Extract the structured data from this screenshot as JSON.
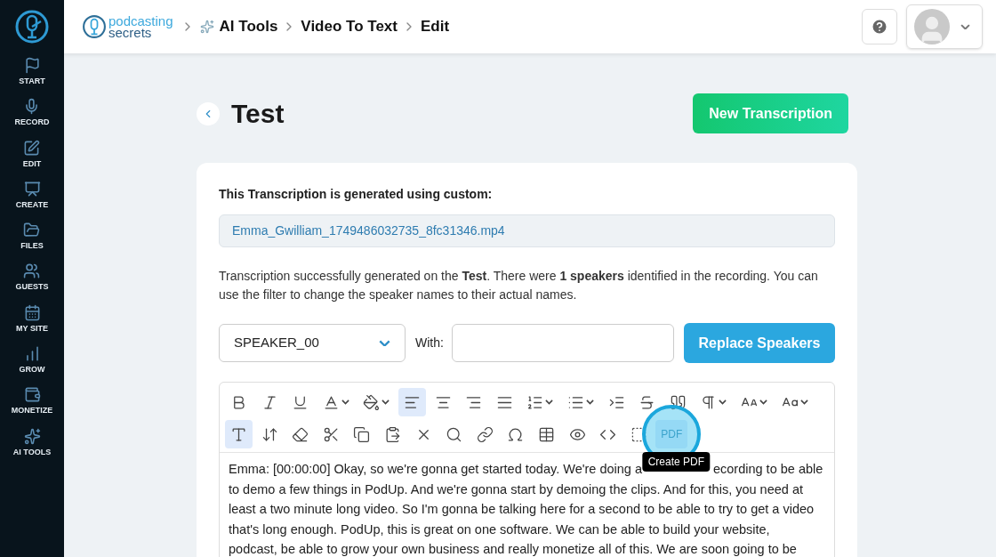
{
  "sidebar": {
    "items": [
      {
        "label": "START"
      },
      {
        "label": "RECORD"
      },
      {
        "label": "EDIT"
      },
      {
        "label": "CREATE"
      },
      {
        "label": "FILES"
      },
      {
        "label": "GUESTS"
      },
      {
        "label": "MY SITE"
      },
      {
        "label": "GROW"
      },
      {
        "label": "MONETIZE"
      },
      {
        "label": "AI TOOLS"
      }
    ]
  },
  "header": {
    "logo": {
      "line_1": "podcasting",
      "line_2": "secrets"
    },
    "breadcrumbs": [
      "AI Tools",
      "Video To Text",
      "Edit"
    ]
  },
  "page": {
    "title": "Test",
    "new_button": "New Transcription"
  },
  "card": {
    "source_label": "This Transcription is generated using custom:",
    "file_name": "Emma_Gwilliam_1749486032735_8fc31346.mp4",
    "info": "Transcription successfully generated on the **Test**. There were **1 speakers** identified in the recording. You can use the filter to change the speaker names to their actual names.",
    "speaker_select": "SPEAKER_00",
    "with_label": "With:",
    "replace_button": "Replace Speakers"
  },
  "editor": {
    "rows": [
      [
        {
          "selected": false,
          "dropdown": false
        },
        {
          "selected": false,
          "dropdown": false
        },
        {
          "selected": false,
          "dropdown": false
        },
        {
          "selected": false,
          "dropdown": true
        },
        {
          "selected": false,
          "dropdown": true
        },
        {
          "selected": true,
          "dropdown": false
        },
        {
          "selected": false,
          "dropdown": false
        },
        {
          "selected": false,
          "dropdown": false
        },
        {
          "selected": false,
          "dropdown": false
        },
        {
          "selected": false,
          "dropdown": true
        },
        {
          "selected": false,
          "dropdown": true
        },
        {
          "selected": false,
          "dropdown": false
        },
        {
          "selected": false,
          "dropdown": false
        },
        {
          "selected": false,
          "dropdown": false
        },
        {
          "selected": false,
          "dropdown": true
        },
        {
          "selected": false,
          "dropdown": true
        },
        {
          "selected": false,
          "dropdown": true
        }
      ],
      [
        {
          "selected": true,
          "dropdown": false
        },
        {
          "selected": false,
          "dropdown": false
        },
        {
          "selected": false,
          "dropdown": false
        },
        {
          "selected": false,
          "dropdown": false
        },
        {
          "selected": false,
          "dropdown": false
        },
        {
          "selected": false,
          "dropdown": false
        },
        {
          "selected": false,
          "dropdown": false
        },
        {
          "selected": false,
          "dropdown": false
        },
        {
          "selected": false,
          "dropdown": false
        },
        {
          "selected": false,
          "dropdown": false
        },
        {
          "selected": false,
          "dropdown": false
        },
        {
          "selected": false,
          "dropdown": false
        },
        {
          "selected": false,
          "dropdown": false
        },
        {
          "selected": false,
          "dropdown": false
        },
        {
          "selected": true,
          "dropdown": false,
          "label": "PDF",
          "highlighted": true,
          "tooltip": "Create PDF"
        }
      ]
    ],
    "content": [
      [
        "Emma: [00:00:00] Okay, so we're gonna get started today. We're doing a",
        "ecording to be able"
      ],
      [
        "to demo a few things in PodUp. And we're gonna start by demoing the clips. And for this, you need at"
      ],
      [
        "least a two minute long video. So I'm gonna be talking here for a second to be able to try to get a video"
      ],
      [
        "that's long enough. PodUp, this is great on one software. We can be able to build your website,"
      ],
      [
        "podcast, be able to grow your own business and really monetize all of this. We are soon going to be"
      ]
    ]
  }
}
